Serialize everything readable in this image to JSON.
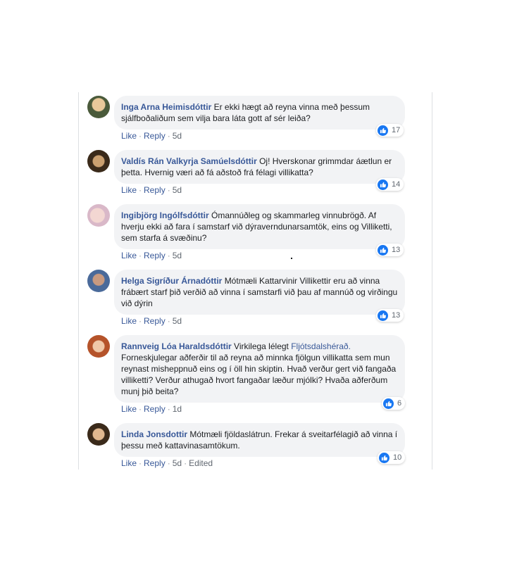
{
  "comments": [
    {
      "author": "Inga Arna Heimisdóttir",
      "text": "Er ekki hægt að reyna vinna með þessum sjálfboðaliðum sem vilja bara láta gott af sér leiða?",
      "like": "Like",
      "reply": "Reply",
      "time": "5d",
      "reactions": "17"
    },
    {
      "author": "Valdís Rán Valkyrja Samúelsdóttir",
      "text": "Oj! Hverskonar grimmdar áætlun er þetta. Hvernig væri að fá aðstoð frá félagi villikatta?",
      "like": "Like",
      "reply": "Reply",
      "time": "5d",
      "reactions": "14"
    },
    {
      "author": "Ingibjörg Ingólfsdóttir",
      "text": "Ómannúðleg og skammarleg vinnubrögð. Af hverju ekki að fara í samstarf við dýraverndunarsamtök, eins og Villiketti, sem starfa á svæðinu?",
      "like": "Like",
      "reply": "Reply",
      "time": "5d",
      "reactions": "13"
    },
    {
      "author": "Helga Sigríður Árnadóttir",
      "text": "Mótmæli Kattarvinir Villikettir eru að vinna frábært starf þið verðið að vinna í samstarfi við þau af mannúð og virðingu við dýrin",
      "like": "Like",
      "reply": "Reply",
      "time": "5d",
      "reactions": "13"
    },
    {
      "author": "Rannveig Lóa Haraldsdóttir",
      "text_before": "Virkilega lélegt",
      "link": "Fljótsdalshérað.",
      "text_after": "Forneskjulegar aðferðir til að reyna að minnka fjölgun villikatta sem mun reynast misheppnuð eins og í öll hin skiptin. Hvað verður gert við fangaða villiketti? Verður athugað hvort fangaðar læður mjólki? Hvaða aðferðum munj þið beita?",
      "like": "Like",
      "reply": "Reply",
      "time": "1d",
      "reactions": "6"
    },
    {
      "author": "Linda Jonsdottir",
      "text": "Mótmæli fjöldaslátrun. Frekar á sveitarfélagið að vinna í þessu með kattavinasamtökum.",
      "like": "Like",
      "reply": "Reply",
      "time": "5d",
      "edited": "Edited",
      "reactions": "10"
    }
  ],
  "colors": {
    "link": "#385898",
    "bubble": "#f2f3f5",
    "like_blue": "#1877f2"
  }
}
